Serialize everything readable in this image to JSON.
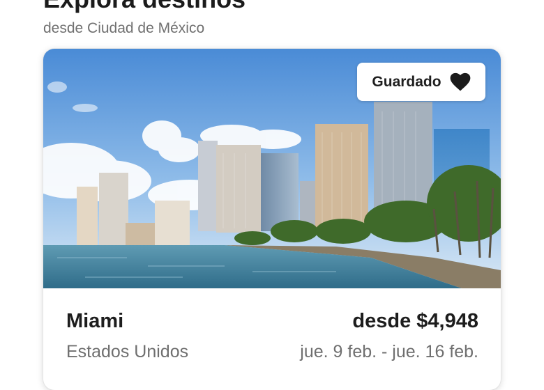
{
  "header": {
    "title": "Explora destinos",
    "subtitle": "desde Ciudad de México"
  },
  "card": {
    "save_label": "Guardado",
    "save_icon": "heart-filled-icon",
    "city": "Miami",
    "country": "Estados Unidos",
    "price": "desde $4,948",
    "dates": "jue. 9 feb. - jue. 16 feb.",
    "image": "miami-skyline-waterfront-photo"
  },
  "colors": {
    "sky_top": "#4f8fd8",
    "sky_bottom": "#cfe1f3",
    "water": "#3d7f9d",
    "palm": "#3f6a2a",
    "text_dark": "#1d1d1d",
    "text_muted": "#6f6f6f"
  }
}
